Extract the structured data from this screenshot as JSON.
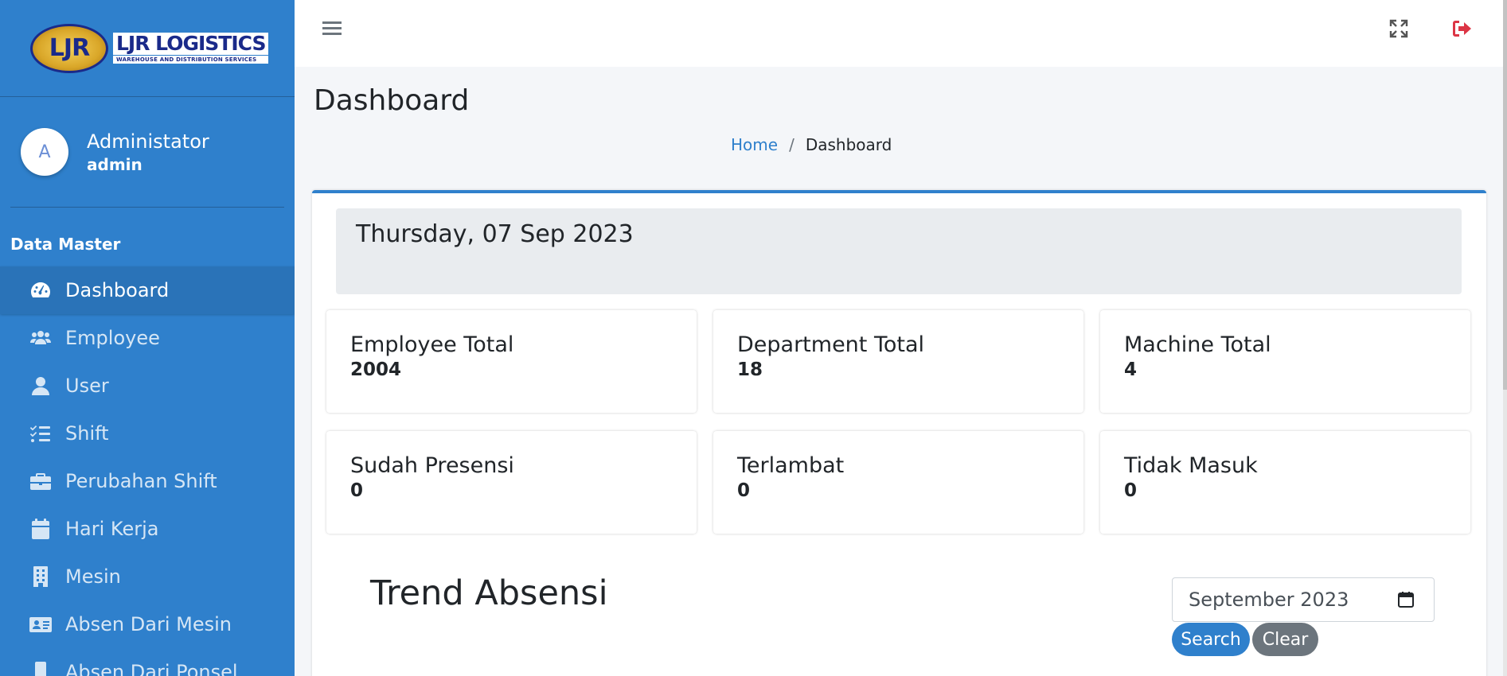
{
  "brand": {
    "logo_initials": "LJR",
    "logo_name": "LJR LOGISTICS",
    "logo_tagline": "WAREHOUSE AND DISTRIBUTION SERVICES"
  },
  "user": {
    "avatar_letter": "A",
    "name": "Administator",
    "role": "admin"
  },
  "sidebar": {
    "section_header": "Data Master",
    "items": [
      {
        "label": "Dashboard",
        "icon": "tachometer-icon",
        "active": true
      },
      {
        "label": "Employee",
        "icon": "users-icon"
      },
      {
        "label": "User",
        "icon": "user-icon"
      },
      {
        "label": "Shift",
        "icon": "list-check-icon"
      },
      {
        "label": "Perubahan Shift",
        "icon": "briefcase-icon"
      },
      {
        "label": "Hari Kerja",
        "icon": "calendar-icon"
      },
      {
        "label": "Mesin",
        "icon": "building-icon"
      },
      {
        "label": "Absen Dari Mesin",
        "icon": "id-card-icon"
      },
      {
        "label": "Absen Dari Ponsel",
        "icon": "mobile-icon"
      }
    ]
  },
  "page": {
    "title": "Dashboard"
  },
  "breadcrumb": {
    "home": "Home",
    "separator": "/",
    "current": "Dashboard"
  },
  "date_banner": "Thursday, 07 Sep 2023",
  "stats": [
    {
      "label": "Employee Total",
      "value": "2004"
    },
    {
      "label": "Department Total",
      "value": "18"
    },
    {
      "label": "Machine Total",
      "value": "4"
    },
    {
      "label": "Sudah Presensi",
      "value": "0"
    },
    {
      "label": "Terlambat",
      "value": "0"
    },
    {
      "label": "Tidak Masuk",
      "value": "0"
    }
  ],
  "trend": {
    "title": "Trend Absensi",
    "month_value": "September 2023",
    "search_label": "Search",
    "clear_label": "Clear"
  },
  "colors": {
    "sidebar": "#2f80cc",
    "accent": "#2f80cc",
    "logout": "#dc3545",
    "secondary": "#6c757d"
  }
}
